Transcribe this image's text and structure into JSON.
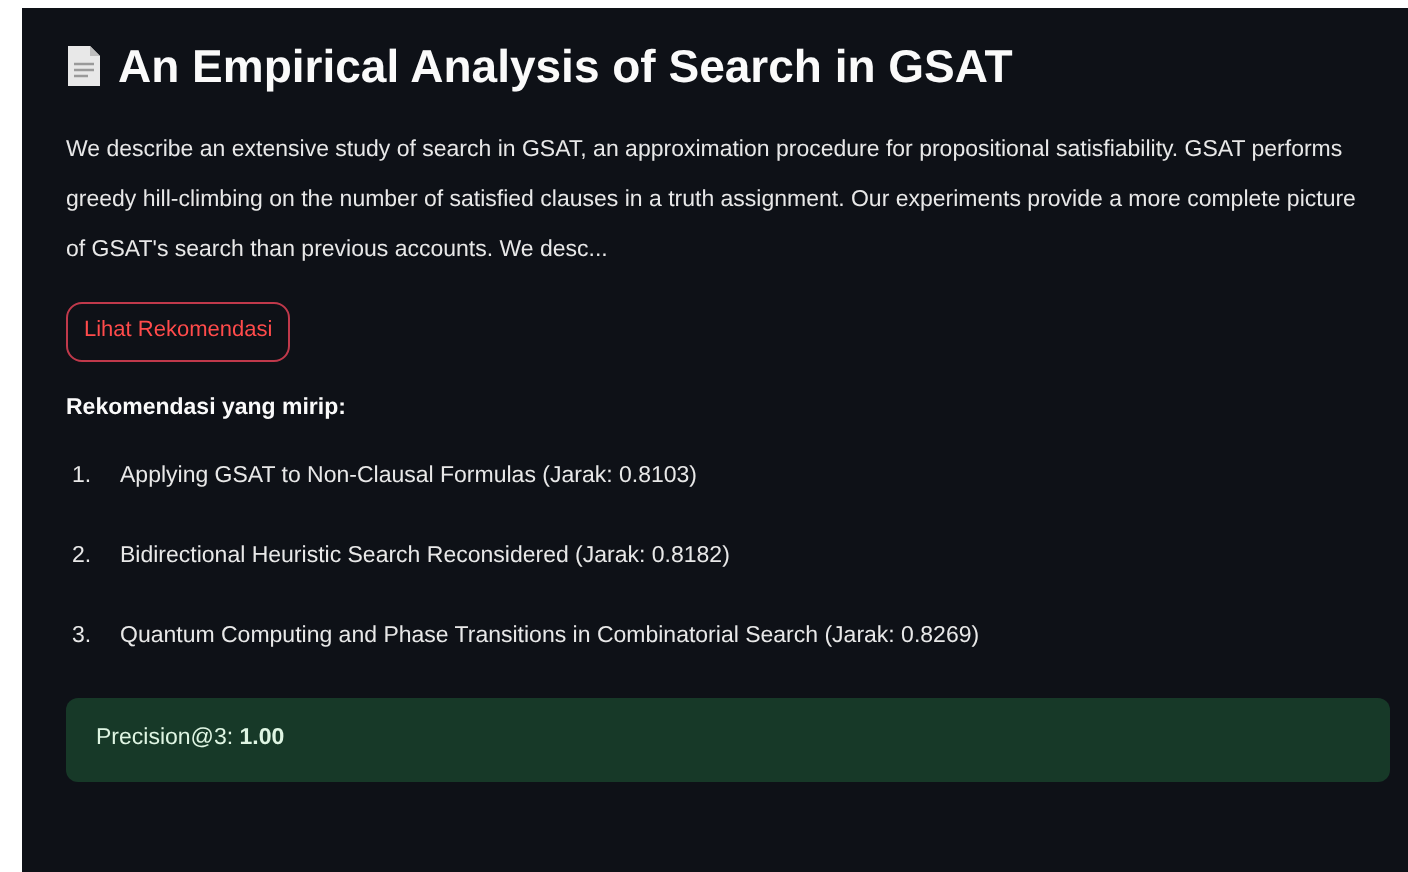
{
  "title": "An Empirical Analysis of Search in GSAT",
  "abstract": "We describe an extensive study of search in GSAT, an approximation procedure for propositional satisfiability. GSAT performs greedy hill-climbing on the number of satisfied clauses in a truth assignment. Our experiments provide a more complete picture of GSAT's search than previous accounts. We desc...",
  "button": {
    "label": "Lihat Rekomendasi"
  },
  "recommendations_heading": "Rekomendasi yang mirip:",
  "recommendations": [
    {
      "number": "1.",
      "text": "Applying GSAT to Non-Clausal Formulas (Jarak: 0.8103)"
    },
    {
      "number": "2.",
      "text": "Bidirectional Heuristic Search Reconsidered (Jarak: 0.8182)"
    },
    {
      "number": "3.",
      "text": "Quantum Computing and Phase Transitions in Combinatorial Search (Jarak: 0.8269)"
    }
  ],
  "result": {
    "text": "Precision@3: **1.00**"
  }
}
